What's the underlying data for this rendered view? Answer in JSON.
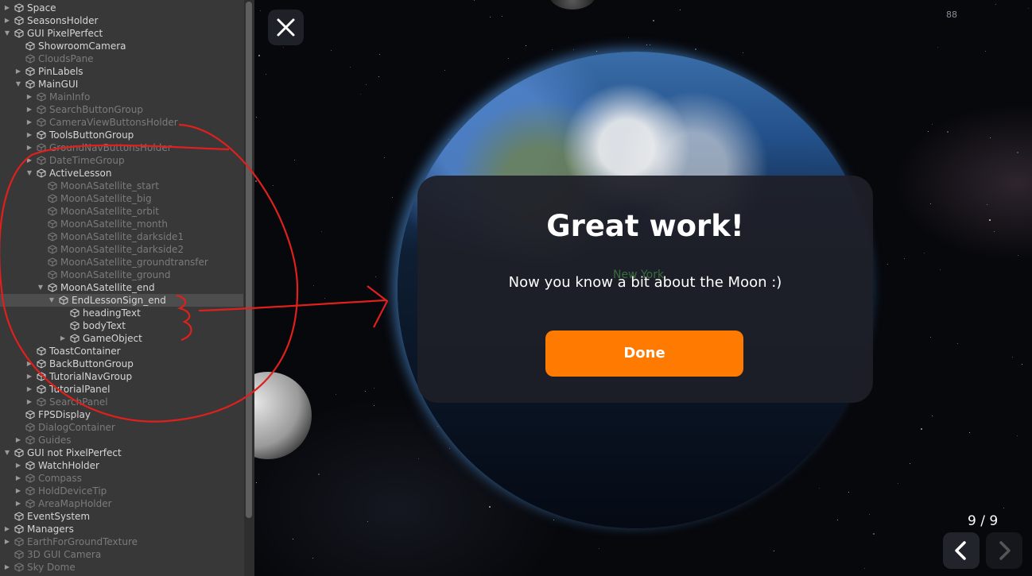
{
  "hierarchy": {
    "rows": [
      {
        "label": "Space",
        "depth": 0,
        "expanded": false,
        "active": true
      },
      {
        "label": "SeasonsHolder",
        "depth": 0,
        "expanded": false,
        "active": true
      },
      {
        "label": "GUI PixelPerfect",
        "depth": 0,
        "expanded": true,
        "active": true
      },
      {
        "label": "ShowroomCamera",
        "depth": 1,
        "expanded": null,
        "active": true
      },
      {
        "label": "CloudsPane",
        "depth": 1,
        "expanded": null,
        "active": false
      },
      {
        "label": "PinLabels",
        "depth": 1,
        "expanded": false,
        "active": true
      },
      {
        "label": "MainGUI",
        "depth": 1,
        "expanded": true,
        "active": true
      },
      {
        "label": "MainInfo",
        "depth": 2,
        "expanded": false,
        "active": false
      },
      {
        "label": "SearchButtonGroup",
        "depth": 2,
        "expanded": false,
        "active": false
      },
      {
        "label": "CameraViewButtonsHolder",
        "depth": 2,
        "expanded": false,
        "active": false
      },
      {
        "label": "ToolsButtonGroup",
        "depth": 2,
        "expanded": false,
        "active": true
      },
      {
        "label": "GroundNavButtonsHolder",
        "depth": 2,
        "expanded": false,
        "active": false
      },
      {
        "label": "DateTimeGroup",
        "depth": 2,
        "expanded": false,
        "active": false
      },
      {
        "label": "ActiveLesson",
        "depth": 2,
        "expanded": true,
        "active": true
      },
      {
        "label": "MoonASatellite_start",
        "depth": 3,
        "expanded": null,
        "active": false
      },
      {
        "label": "MoonASatellite_big",
        "depth": 3,
        "expanded": null,
        "active": false
      },
      {
        "label": "MoonASatellite_orbit",
        "depth": 3,
        "expanded": null,
        "active": false
      },
      {
        "label": "MoonASatellite_month",
        "depth": 3,
        "expanded": null,
        "active": false
      },
      {
        "label": "MoonASatellite_darkside1",
        "depth": 3,
        "expanded": null,
        "active": false
      },
      {
        "label": "MoonASatellite_darkside2",
        "depth": 3,
        "expanded": null,
        "active": false
      },
      {
        "label": "MoonASatellite_groundtransfer",
        "depth": 3,
        "expanded": null,
        "active": false
      },
      {
        "label": "MoonASatellite_ground",
        "depth": 3,
        "expanded": null,
        "active": false
      },
      {
        "label": "MoonASatellite_end",
        "depth": 3,
        "expanded": true,
        "active": true
      },
      {
        "label": "EndLessonSign_end",
        "depth": 4,
        "expanded": true,
        "active": true,
        "selected": true
      },
      {
        "label": "headingText",
        "depth": 5,
        "expanded": null,
        "active": true
      },
      {
        "label": "bodyText",
        "depth": 5,
        "expanded": null,
        "active": true
      },
      {
        "label": "GameObject",
        "depth": 5,
        "expanded": false,
        "active": true
      },
      {
        "label": "ToastContainer",
        "depth": 2,
        "expanded": null,
        "active": true
      },
      {
        "label": "BackButtonGroup",
        "depth": 2,
        "expanded": false,
        "active": true
      },
      {
        "label": "TutorialNavGroup",
        "depth": 2,
        "expanded": false,
        "active": true
      },
      {
        "label": "TutorialPanel",
        "depth": 2,
        "expanded": false,
        "active": true
      },
      {
        "label": "SearchPanel",
        "depth": 2,
        "expanded": false,
        "active": false
      },
      {
        "label": "FPSDisplay",
        "depth": 1,
        "expanded": null,
        "active": true
      },
      {
        "label": "DialogContainer",
        "depth": 1,
        "expanded": null,
        "active": false
      },
      {
        "label": "Guides",
        "depth": 1,
        "expanded": false,
        "active": false
      },
      {
        "label": "GUI not PixelPerfect",
        "depth": 0,
        "expanded": true,
        "active": true
      },
      {
        "label": "WatchHolder",
        "depth": 1,
        "expanded": false,
        "active": true
      },
      {
        "label": "Compass",
        "depth": 1,
        "expanded": false,
        "active": false
      },
      {
        "label": "HoldDeviceTip",
        "depth": 1,
        "expanded": false,
        "active": false
      },
      {
        "label": "AreaMapHolder",
        "depth": 1,
        "expanded": false,
        "active": false
      },
      {
        "label": "EventSystem",
        "depth": 0,
        "expanded": null,
        "active": true
      },
      {
        "label": "Managers",
        "depth": 0,
        "expanded": false,
        "active": true
      },
      {
        "label": "EarthForGroundTexture",
        "depth": 0,
        "expanded": false,
        "active": false
      },
      {
        "label": "3D GUI Camera",
        "depth": 0,
        "expanded": null,
        "active": false
      },
      {
        "label": "Sky Dome",
        "depth": 0,
        "expanded": false,
        "active": false
      }
    ]
  },
  "game": {
    "fps": "88",
    "city_label": "New York",
    "dialog": {
      "heading": "Great work!",
      "body": "Now you know a bit about the Moon :)",
      "done_label": "Done"
    },
    "page_counter": "9 / 9"
  },
  "colors": {
    "accent": "#ff7a00",
    "dialog_bg": "#1e1f28",
    "annotation": "#e0201c",
    "hierarchy_bg": "#383838"
  },
  "icons": [
    "close-icon",
    "chevron-left-icon",
    "chevron-right-icon",
    "gameobject-cube-icon"
  ]
}
